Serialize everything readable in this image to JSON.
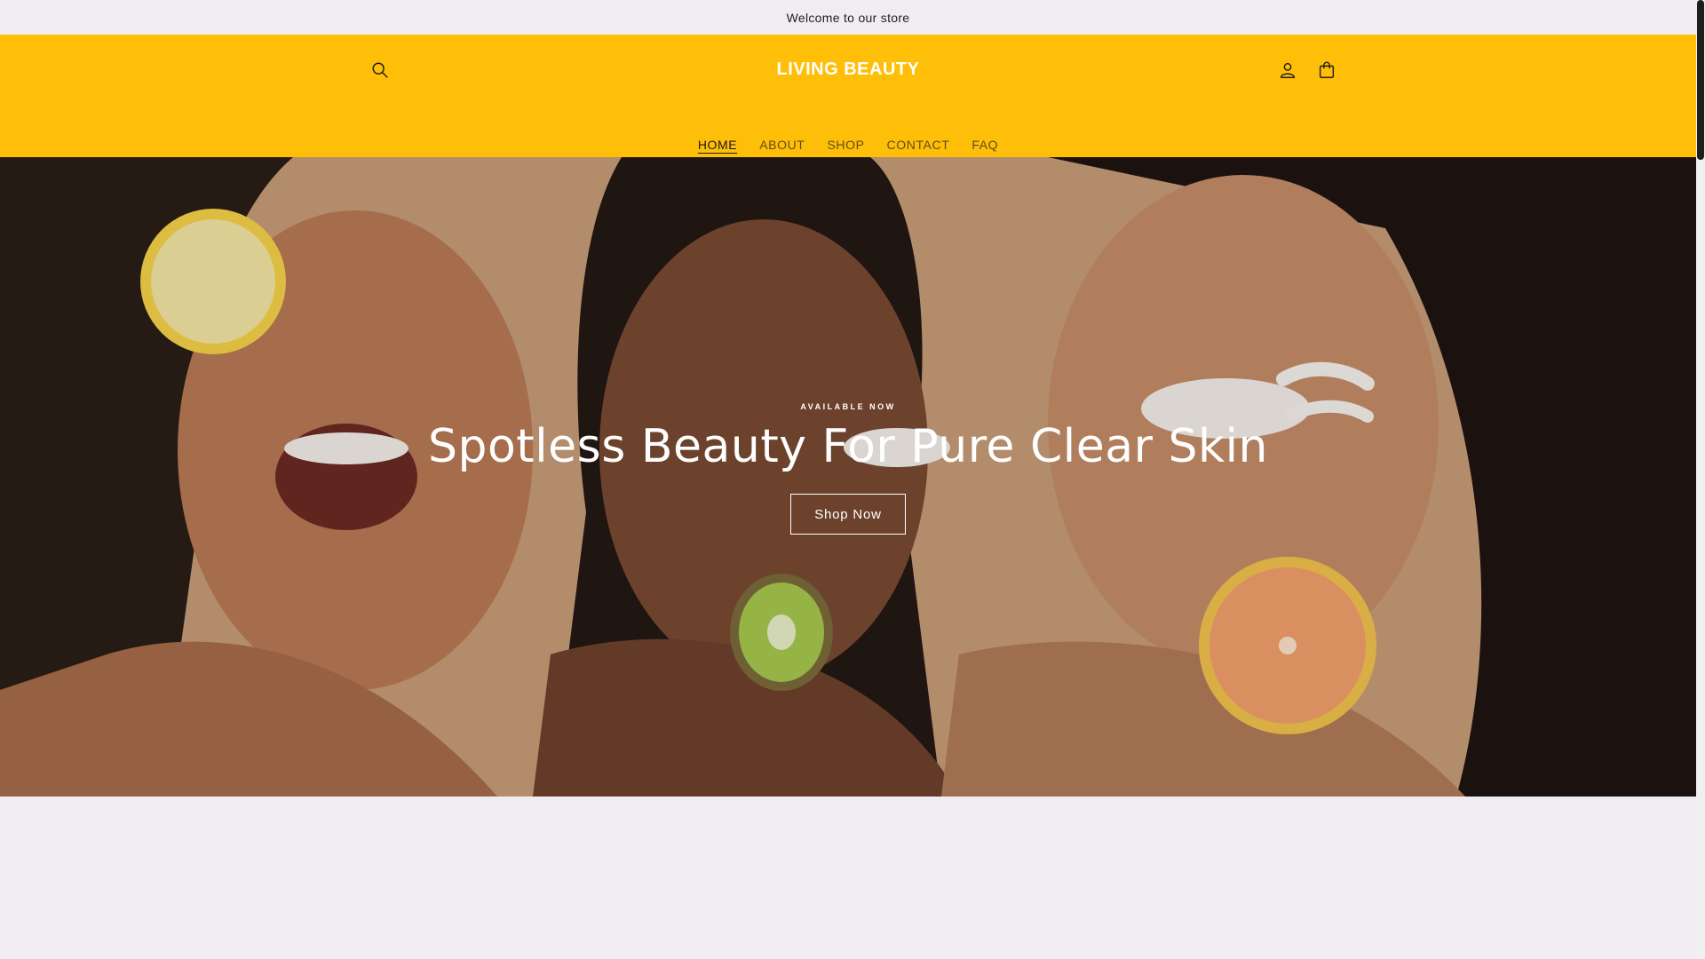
{
  "announcement": {
    "text": "Welcome to our store"
  },
  "header": {
    "logo": "LIVING BEAUTY",
    "icons": {
      "search": "search-icon",
      "account": "user-icon",
      "cart": "bag-icon"
    },
    "nav": [
      {
        "label": "HOME",
        "active": true
      },
      {
        "label": "ABOUT"
      },
      {
        "label": "SHOP"
      },
      {
        "label": "CONTACT"
      },
      {
        "label": "FAQ"
      }
    ]
  },
  "hero": {
    "eyebrow": "AVAILABLE NOW",
    "headline": "Spotless Beauty For Pure Clear Skin",
    "cta_label": "Shop Now"
  },
  "colors": {
    "header_bg": "#ffbe07",
    "page_bg": "#f1ecf2",
    "hero_bg": "#c59a76"
  }
}
